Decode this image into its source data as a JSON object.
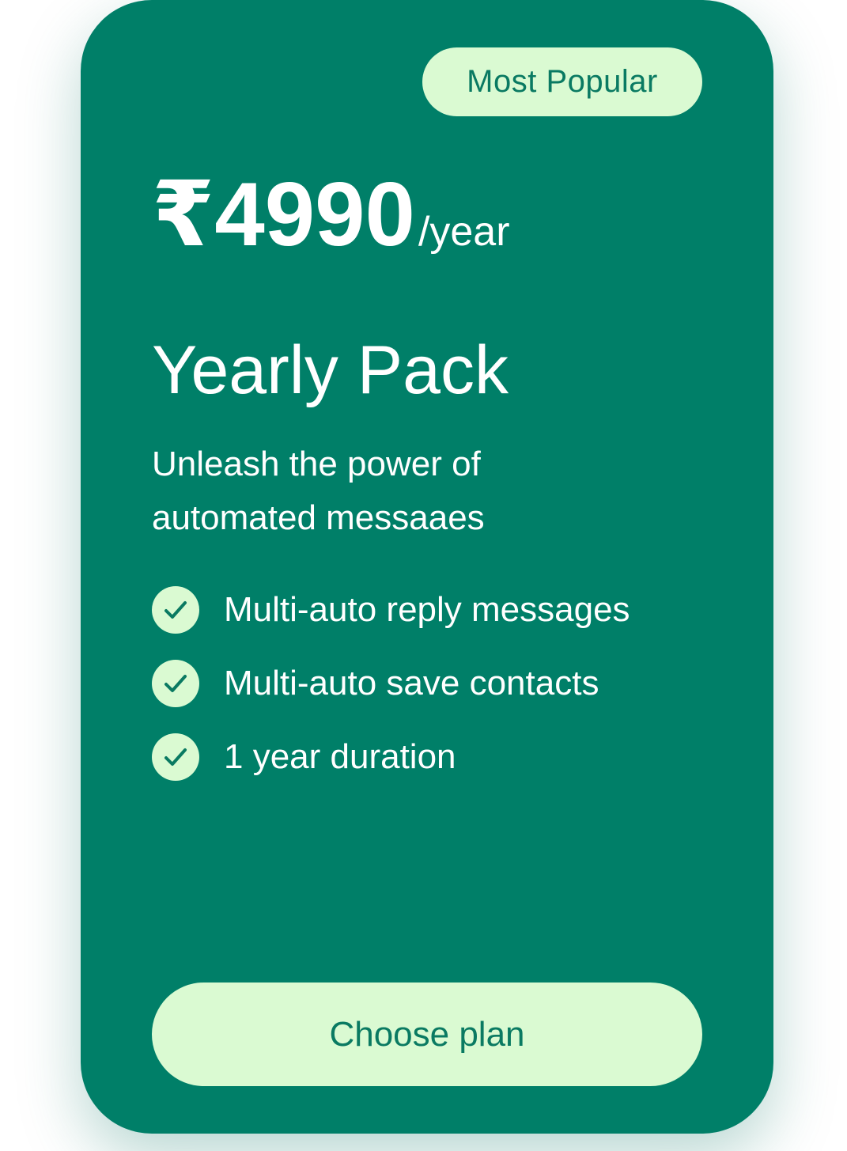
{
  "colors": {
    "card_bg": "#007f68",
    "pale_green": "#dafad2",
    "accent_dark": "#0a7a62"
  },
  "card": {
    "badge": "Most Popular",
    "price": {
      "amount": "₹4990",
      "period": "/year"
    },
    "plan_name": "Yearly Pack",
    "tagline": "Unleash the power of automated messaaes",
    "features": [
      {
        "icon": "check-circle-icon",
        "label": "Multi-auto reply messages"
      },
      {
        "icon": "check-circle-icon",
        "label": "Multi-auto save contacts"
      },
      {
        "icon": "check-circle-icon",
        "label": "1 year duration"
      }
    ],
    "cta_label": "Choose plan"
  }
}
